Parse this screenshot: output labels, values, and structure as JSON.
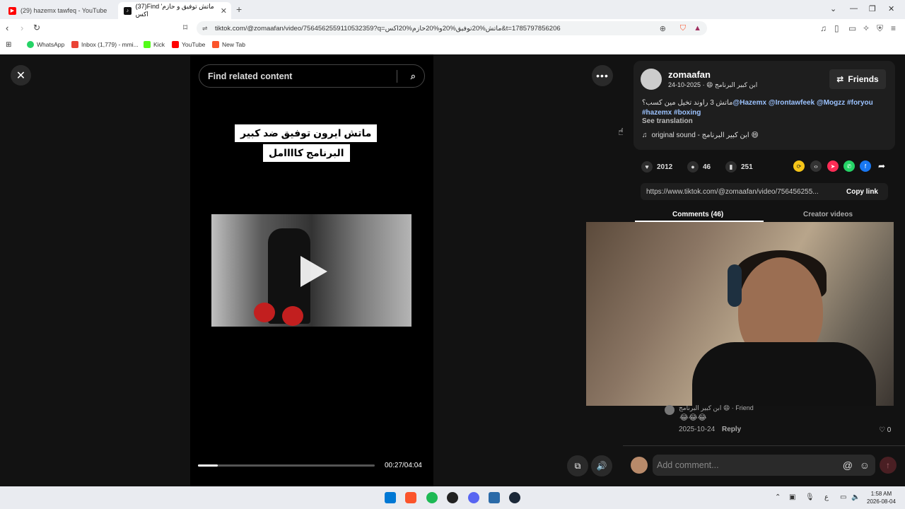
{
  "browser": {
    "tabs": [
      {
        "title": "(29) hazemx tawfeq - YouTube"
      },
      {
        "title": "(37)Find 'ماتش توفيق و حازم اكس"
      }
    ],
    "new_tab": "+",
    "url": "tiktok.com/@zomaafan/video/7564562559110532359?q=ماتش%20توفيق%20و%20حازم%20اكس&t=1785797856206",
    "bookmarks": [
      "WhatsApp",
      "Inbox (1,779) - mmi...",
      "Kick",
      "YouTube",
      "New Tab"
    ]
  },
  "video": {
    "search_placeholder": "Find related content",
    "caption_line1": "ماتش ايرون توفيق ضد كبير",
    "caption_line2": "البرنامج كاااامل",
    "progress_fraction": 0.112,
    "time": "00:27/04:04"
  },
  "post": {
    "username": "zomaafan",
    "subtitle": "ابن كبير البرنامج 😄 · 2025-10-24",
    "friends_label": "Friends",
    "desc_text": "ماتش 3 راوند تخيل مين كسب؟",
    "desc_tags": [
      "@Hazemx",
      "@Irontawfeek",
      "@Mogzz",
      "#foryou",
      "#hazemx",
      "#boxing"
    ],
    "see_translation": "See translation",
    "sound": "original sound - ابن كبير البرنامج 😄",
    "likes": "2012",
    "comments": "46",
    "saves": "251",
    "link": "https://www.tiktok.com/@zomaafan/video/756456255...",
    "copy_link": "Copy link",
    "tab_comments": "Comments (46)",
    "tab_creator": "Creator videos"
  },
  "comment": {
    "author": "ابن كبير البرنامج 😄 · Friend",
    "text": "😂😂😂",
    "date": "2025-10-24",
    "reply": "Reply",
    "likes": "0",
    "add_placeholder": "Add comment..."
  },
  "system": {
    "time": "1:58 AM",
    "date": "2026-08-04",
    "lang": "ع"
  },
  "colors": {
    "accent": "#fe2c55",
    "tag": "#9cc3ff"
  }
}
